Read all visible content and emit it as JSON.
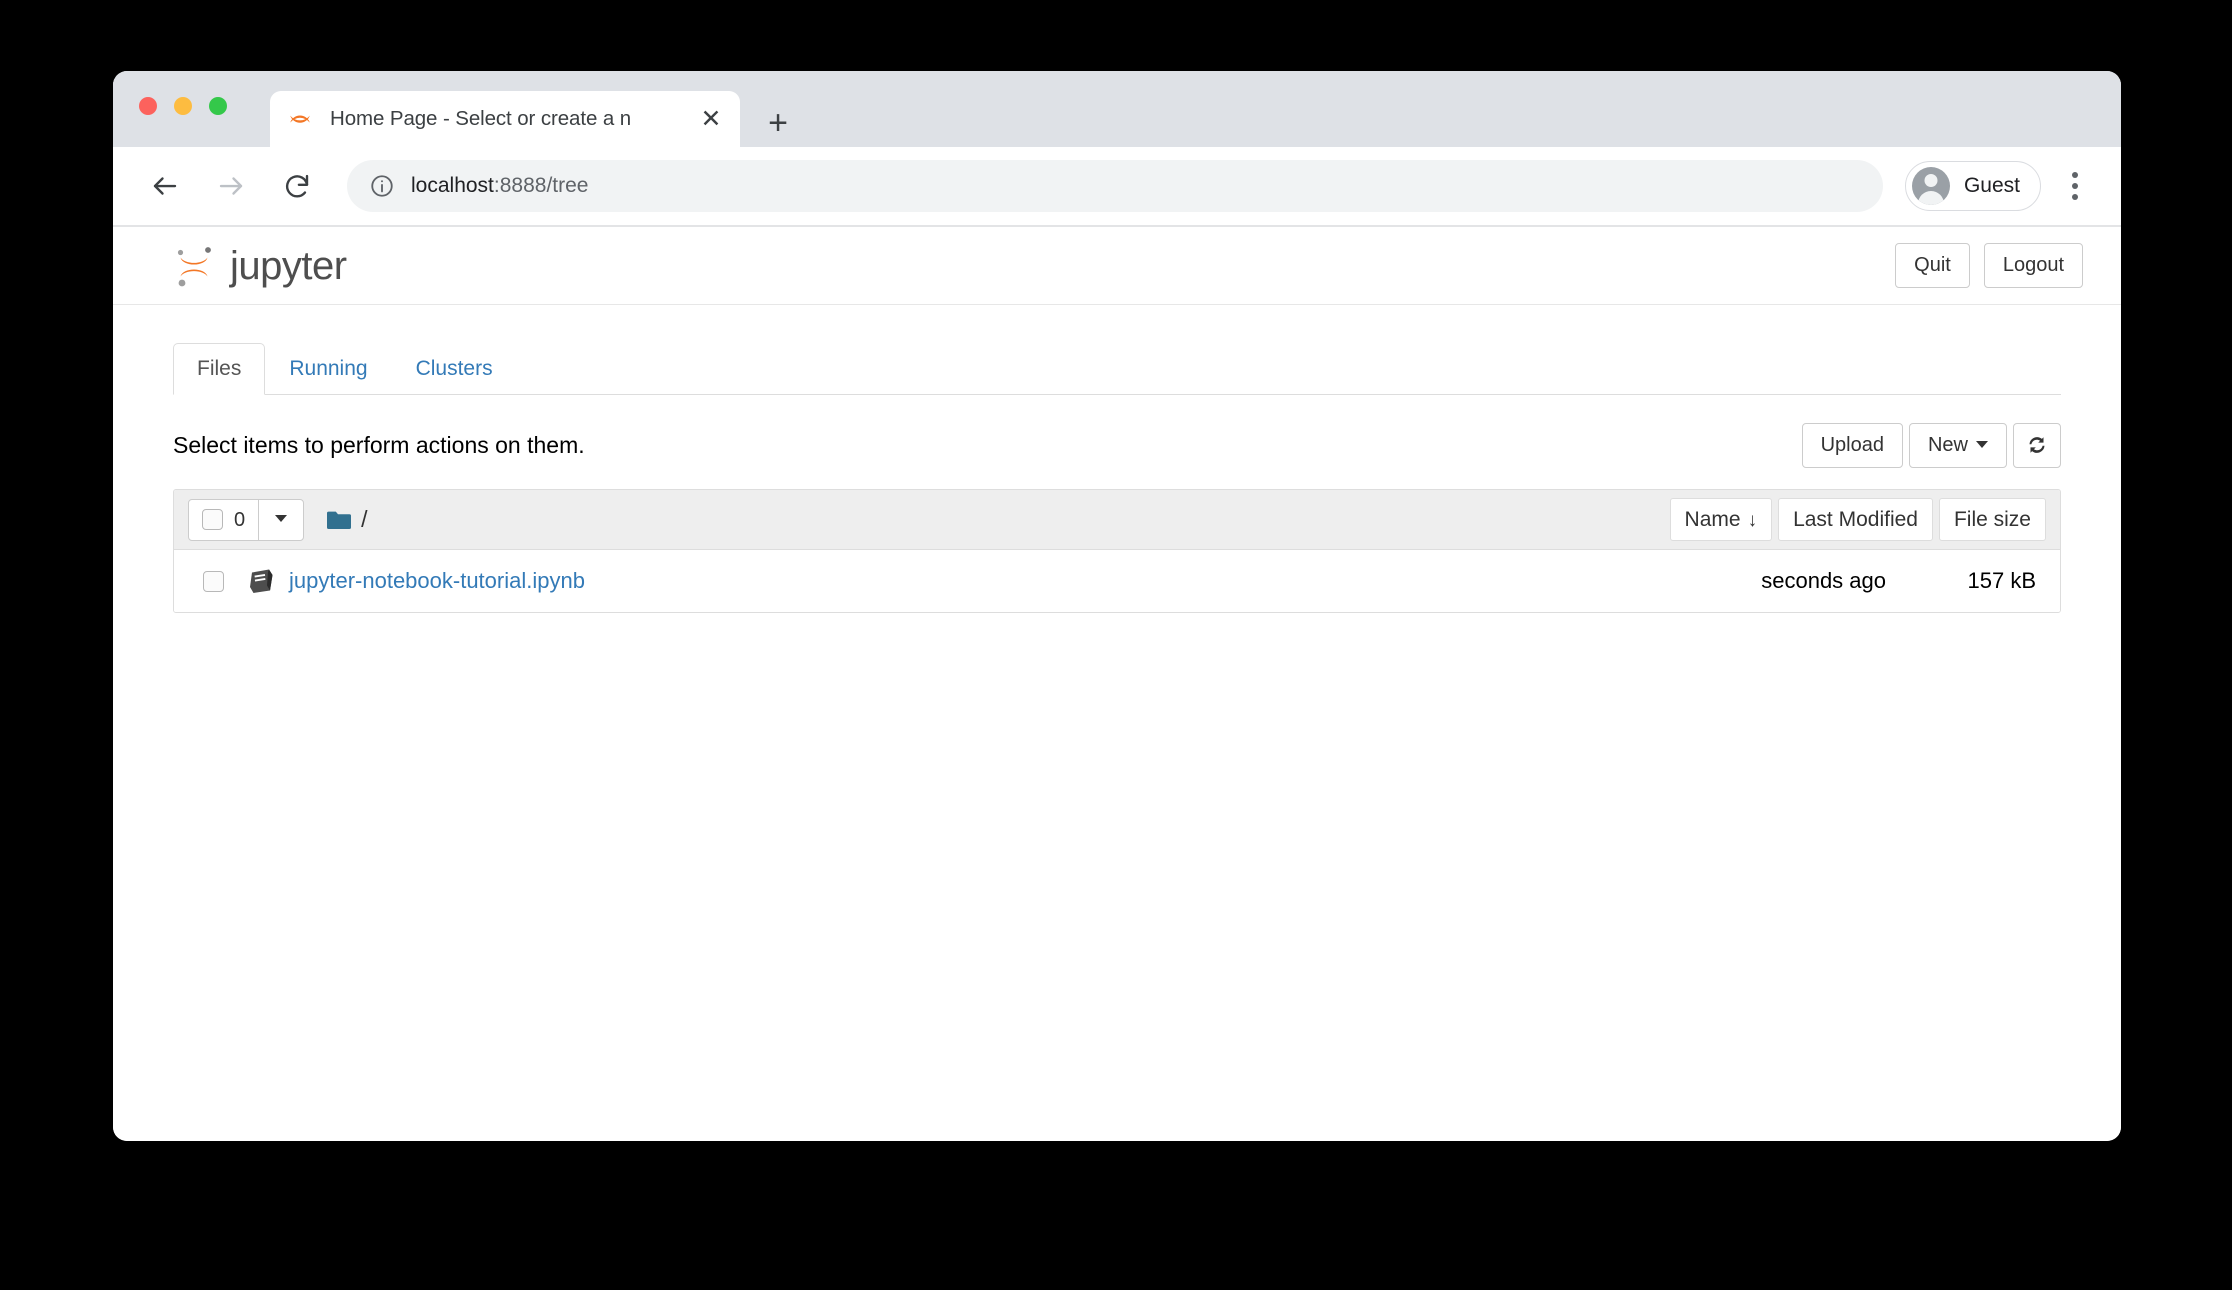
{
  "browser": {
    "tab": {
      "title": "Home Page - Select or create a n",
      "favicon_name": "jupyter-favicon",
      "close_label": "✕",
      "newtab_label": "+"
    },
    "toolbar": {
      "back_icon": "arrow-left-icon",
      "forward_icon": "arrow-right-icon",
      "reload_icon": "reload-icon",
      "site_info_icon": "info-circle-icon",
      "url_host": "localhost",
      "url_rest": ":8888/tree",
      "profile_label": "Guest",
      "menu_icon": "kebab-menu-icon"
    }
  },
  "jupyter": {
    "brand": "jupyter",
    "header_buttons": [
      {
        "label": "Quit",
        "name": "quit-button"
      },
      {
        "label": "Logout",
        "name": "logout-button"
      }
    ],
    "tabs": [
      {
        "label": "Files",
        "active": true
      },
      {
        "label": "Running",
        "active": false
      },
      {
        "label": "Clusters",
        "active": false
      }
    ],
    "hint": "Select items to perform actions on them.",
    "actions": {
      "upload": "Upload",
      "new": "New",
      "refresh_icon": "refresh-icon"
    },
    "list_header": {
      "select_all_count": "0",
      "select_all_caret": "dropdown-caret",
      "breadcrumb_root": "/",
      "folder_icon": "folder-icon",
      "columns": [
        {
          "label": "Name",
          "sort_arrow": "↓",
          "sorted": true
        },
        {
          "label": "Last Modified",
          "sort_arrow": "",
          "sorted": false
        },
        {
          "label": "File size",
          "sort_arrow": "",
          "sorted": false
        }
      ]
    },
    "files": [
      {
        "name": "jupyter-notebook-tutorial.ipynb",
        "icon": "notebook-icon",
        "modified": "seconds ago",
        "size": "157 kB"
      }
    ]
  },
  "colors": {
    "jupyter_orange": "#F37726",
    "link_blue": "#337ab7",
    "folder_blue": "#31708f",
    "tabstrip_gray": "#dee1e6"
  }
}
